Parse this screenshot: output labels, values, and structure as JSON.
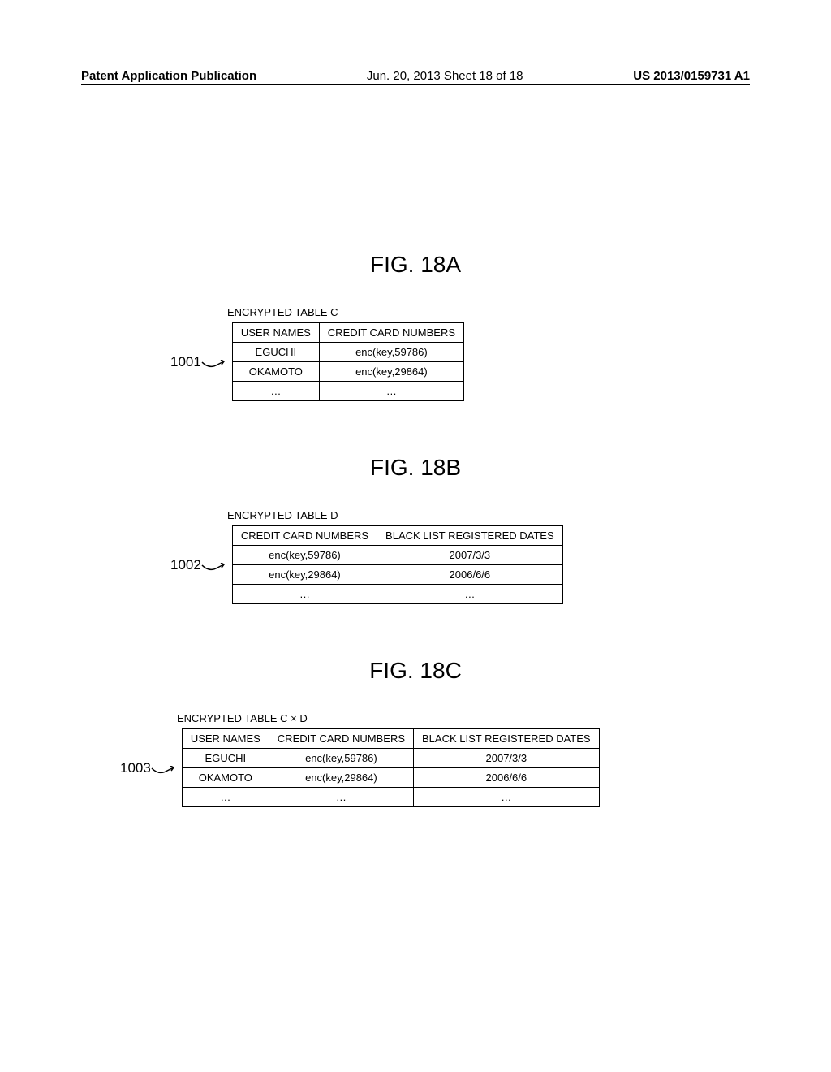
{
  "header": {
    "left": "Patent Application Publication",
    "center": "Jun. 20, 2013  Sheet 18 of 18",
    "right": "US 2013/0159731 A1"
  },
  "figA": {
    "title": "FIG. 18A",
    "tableLabel": "ENCRYPTED TABLE C",
    "refNum": "1001",
    "headers": [
      "USER NAMES",
      "CREDIT CARD NUMBERS"
    ],
    "rows": [
      [
        "EGUCHI",
        "enc(key,59786)"
      ],
      [
        "OKAMOTO",
        "enc(key,29864)"
      ],
      [
        "…",
        "…"
      ]
    ]
  },
  "figB": {
    "title": "FIG. 18B",
    "tableLabel": "ENCRYPTED TABLE D",
    "refNum": "1002",
    "headers": [
      "CREDIT CARD NUMBERS",
      "BLACK LIST REGISTERED DATES"
    ],
    "rows": [
      [
        "enc(key,59786)",
        "2007/3/3"
      ],
      [
        "enc(key,29864)",
        "2006/6/6"
      ],
      [
        "…",
        "…"
      ]
    ]
  },
  "figC": {
    "title": "FIG. 18C",
    "tableLabel": "ENCRYPTED TABLE C × D",
    "refNum": "1003",
    "headers": [
      "USER NAMES",
      "CREDIT CARD NUMBERS",
      "BLACK LIST REGISTERED DATES"
    ],
    "rows": [
      [
        "EGUCHI",
        "enc(key,59786)",
        "2007/3/3"
      ],
      [
        "OKAMOTO",
        "enc(key,29864)",
        "2006/6/6"
      ],
      [
        "…",
        "…",
        "…"
      ]
    ]
  }
}
